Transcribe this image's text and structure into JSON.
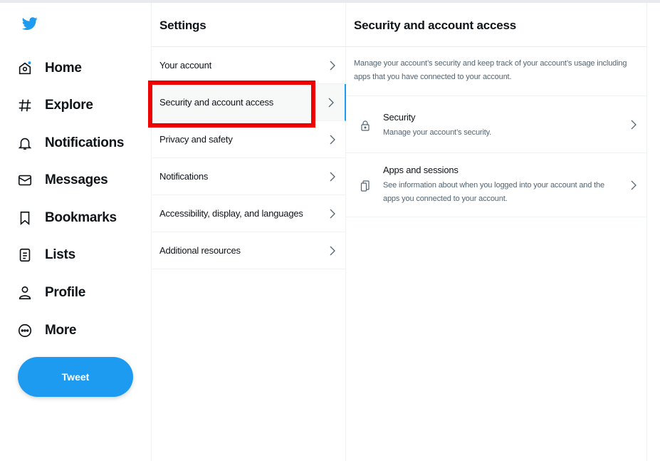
{
  "nav": {
    "logo_icon": "twitter-bird-icon",
    "items": [
      {
        "label": "Home",
        "icon": "home-icon"
      },
      {
        "label": "Explore",
        "icon": "hashtag-icon"
      },
      {
        "label": "Notifications",
        "icon": "bell-icon"
      },
      {
        "label": "Messages",
        "icon": "envelope-icon"
      },
      {
        "label": "Bookmarks",
        "icon": "bookmark-icon"
      },
      {
        "label": "Lists",
        "icon": "list-icon"
      },
      {
        "label": "Profile",
        "icon": "person-icon"
      },
      {
        "label": "More",
        "icon": "more-circle-icon"
      }
    ],
    "tweet_label": "Tweet"
  },
  "settings": {
    "title": "Settings",
    "items": [
      {
        "label": "Your account"
      },
      {
        "label": "Security and account access",
        "active": true
      },
      {
        "label": "Privacy and safety"
      },
      {
        "label": "Notifications"
      },
      {
        "label": "Accessibility, display, and languages"
      },
      {
        "label": "Additional resources"
      }
    ]
  },
  "detail": {
    "title": "Security and account access",
    "description": "Manage your account’s security and keep track of your account’s usage including apps that you have connected to your account.",
    "rows": [
      {
        "title": "Security",
        "subtitle": "Manage your account’s security.",
        "icon": "lock-icon"
      },
      {
        "title": "Apps and sessions",
        "subtitle": "See information about when you logged into your account and the apps you connected to your account.",
        "icon": "devices-icon"
      }
    ]
  },
  "colors": {
    "accent": "#1d9bf0",
    "highlight": "#ee0000",
    "text": "#0f1419",
    "secondary_text": "#536471"
  }
}
